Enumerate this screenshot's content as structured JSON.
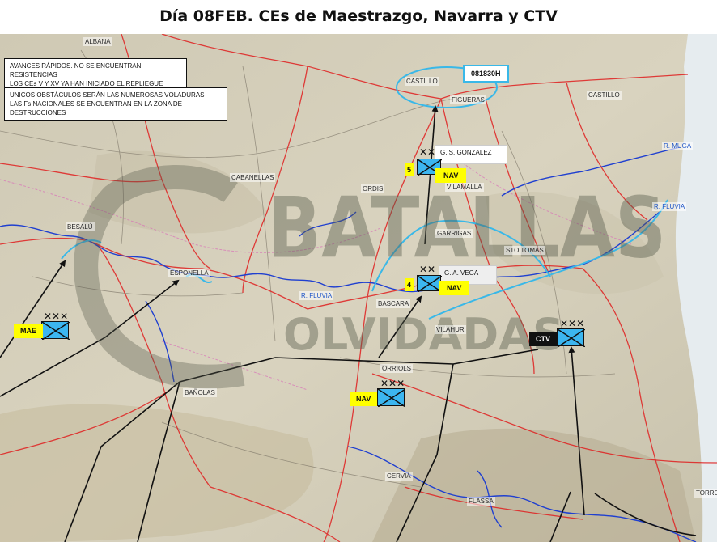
{
  "title": "Día 08FEB. CEs de Maestrazgo, Navarra y CTV",
  "notes": [
    {
      "line1": "AVANCES RÁPIDOS. NO SE ENCUENTRAN RESISTENCIAS",
      "line2": "LOS CEs V Y XV YA HAN INICIADO EL REPLIEGUE"
    },
    {
      "line1": "UNICOS OBSTÁCULOS SERÁN LAS NUMEROSAS VOLADURAS",
      "line2": "LAS Fs NACIONALES SE ENCUENTRAN EN  LA ZONA DE DESTRUCCIONES"
    }
  ],
  "dtg": "081830H",
  "places": {
    "albana": "ALBANA",
    "castillo_w": "CASTILLO",
    "figueras": "FIGUERAS",
    "castillo_e": "CASTILLO",
    "cabanellas": "CABANELLAS",
    "ordis": "ORDIS",
    "vilamalla": "VILAMALLA",
    "besalu": "BESALÚ",
    "garrigas": "GARRIGAS",
    "sto_tomas": "STO TOMÁS",
    "esponella": "ESPONELLA",
    "bascara": "BASCARA",
    "vilahur": "VILAHUR",
    "orriols": "ORRIOLS",
    "banolas": "BAÑOLAS",
    "cervia": "CERVIÁ",
    "flassa": "FLASSA",
    "torroella": "TORRO"
  },
  "rivers": {
    "muga": "R. MUGA",
    "fluvia_e": "R. FLUVIA",
    "fluvia_w": "R. FLUVIA"
  },
  "units": {
    "gonzalez": {
      "commander": "G. S. GONZALEZ",
      "number": "5",
      "tag": "NAV",
      "echelon": "✕✕"
    },
    "vega": {
      "commander": "G. A. VEGA",
      "number": "4",
      "tag": "NAV",
      "echelon": "✕✕"
    },
    "mae": {
      "tag": "MAE",
      "echelon": "✕✕✕"
    },
    "nav": {
      "tag": "NAV",
      "echelon": "✕✕✕"
    },
    "ctv": {
      "tag": "CTV",
      "echelon": "✕✕✕"
    }
  },
  "watermark": {
    "line1": "BATALLAS",
    "line2": "OLVIDADAS"
  },
  "colors": {
    "unit_fill": "#3cb6f0",
    "label_yellow": "#ffff00",
    "road_red": "#e02020",
    "river_blue": "#1f3fd0",
    "objective_cyan": "#39b8e8"
  }
}
